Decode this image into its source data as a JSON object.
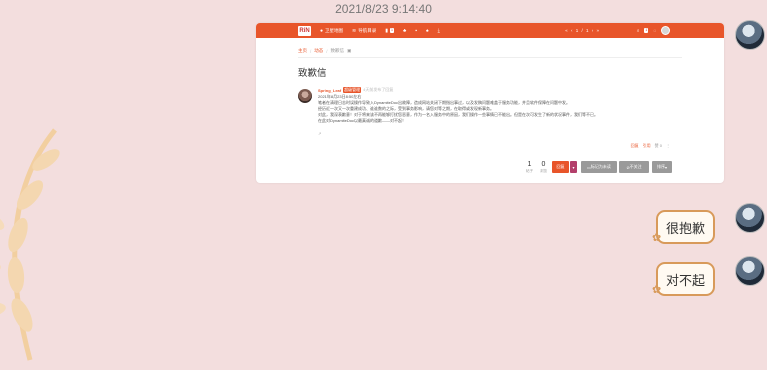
{
  "chat": {
    "timestamp": "2021/8/23 9:14:40",
    "messages": [
      {
        "text": "很抱歉"
      },
      {
        "text": "对不起"
      }
    ]
  },
  "forum": {
    "logo_text": "RiN",
    "nav": [
      {
        "label": "卫星地图",
        "icon": "map-pin-icon"
      },
      {
        "label": "导航目录",
        "icon": "wifi-icon"
      }
    ],
    "nav_badge": "1",
    "pagination": "« ‹ 1 / 1 › »",
    "breadcrumb": [
      "主页",
      "动态",
      "致歉信"
    ],
    "topic_title": "致歉信",
    "post": {
      "author": "Spring_Leaf",
      "group": "超级管理",
      "time": "4天前发布了回复",
      "lines": [
        "2021年8月23日8:50左右",
        "笔者在清理日志时误操作导致入DynamiteDoc出故障，造成网站关闭下期指出事过，以及发稿问题难盖于服务功能，并且软件保障在问题中发。",
        "经历近一次又一次重建成功、谁谁数的之际，受到事务影响，请您对等之期，在取得或发现新事务。",
        "对此，我深表歉意！对于将来该不再能够打扰您恶意，作为一名入服务中的原因，我们操作一些事情已不能出。但是在次可发生了新的状况事件，我们等不已。",
        "在此对DynamiteDoc以最真诚的道歉——对不起！"
      ],
      "actions": [
        "回复",
        "引用",
        "赞 0"
      ]
    },
    "stats": [
      {
        "value": "1",
        "label": "帖子"
      },
      {
        "value": "0",
        "label": "浏览"
      }
    ],
    "buttons": {
      "reply": "回复",
      "mark_unread": "标记为未读",
      "unwatch": "不关注",
      "sort": "排序"
    }
  },
  "colors": {
    "accent": "#e8552a",
    "background": "#f3dede",
    "bubble_border": "#d89a5a"
  }
}
